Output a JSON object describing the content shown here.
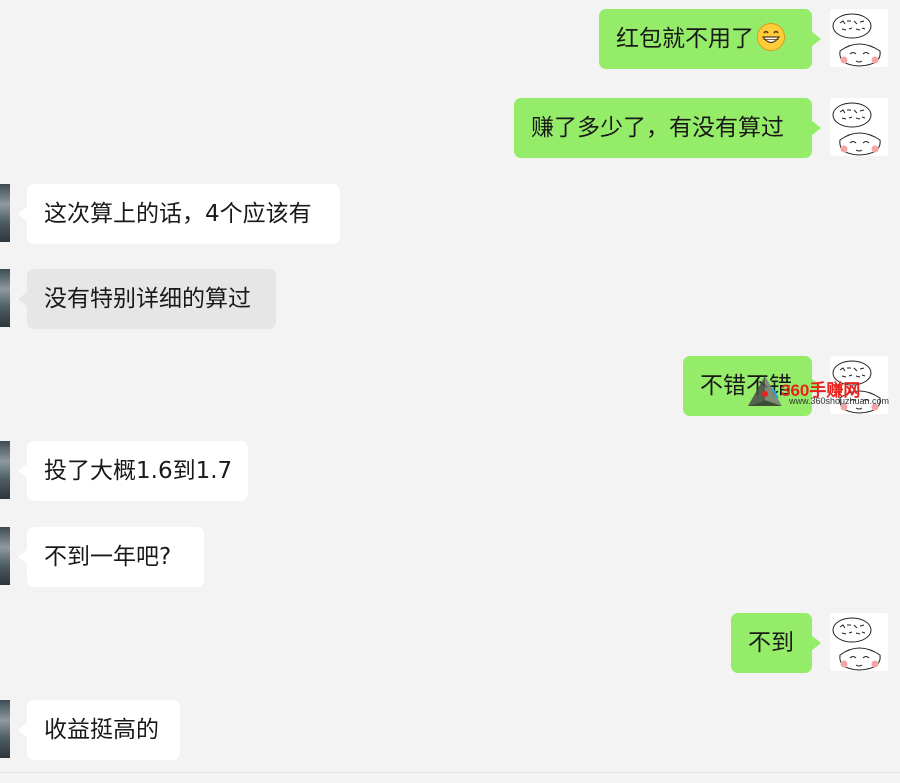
{
  "messages": [
    {
      "id": 1,
      "side": "me",
      "text": "红包就不用了",
      "emoji": "grinning-face-emoji"
    },
    {
      "id": 2,
      "side": "me",
      "text": "赚了多少了，有没有算过"
    },
    {
      "id": 3,
      "side": "other",
      "text": "这次算上的话，4个应该有"
    },
    {
      "id": 4,
      "side": "other",
      "text": "没有特别详细的算过"
    },
    {
      "id": 5,
      "side": "me",
      "text": "不错不错"
    },
    {
      "id": 6,
      "side": "other",
      "text": "投了大概1.6到1.7"
    },
    {
      "id": 7,
      "side": "other",
      "text": "不到一年吧?"
    },
    {
      "id": 8,
      "side": "me",
      "text": "不到"
    },
    {
      "id": 9,
      "side": "other",
      "text": "收益挺高的"
    }
  ],
  "watermark": {
    "brand": "360手赚网",
    "url": "www.360shouzhuan.com"
  },
  "colors": {
    "background": "#f3f3f3",
    "my_bubble": "#95ec69",
    "other_bubble": "#ffffff",
    "watermark_red": "#e8231d"
  }
}
